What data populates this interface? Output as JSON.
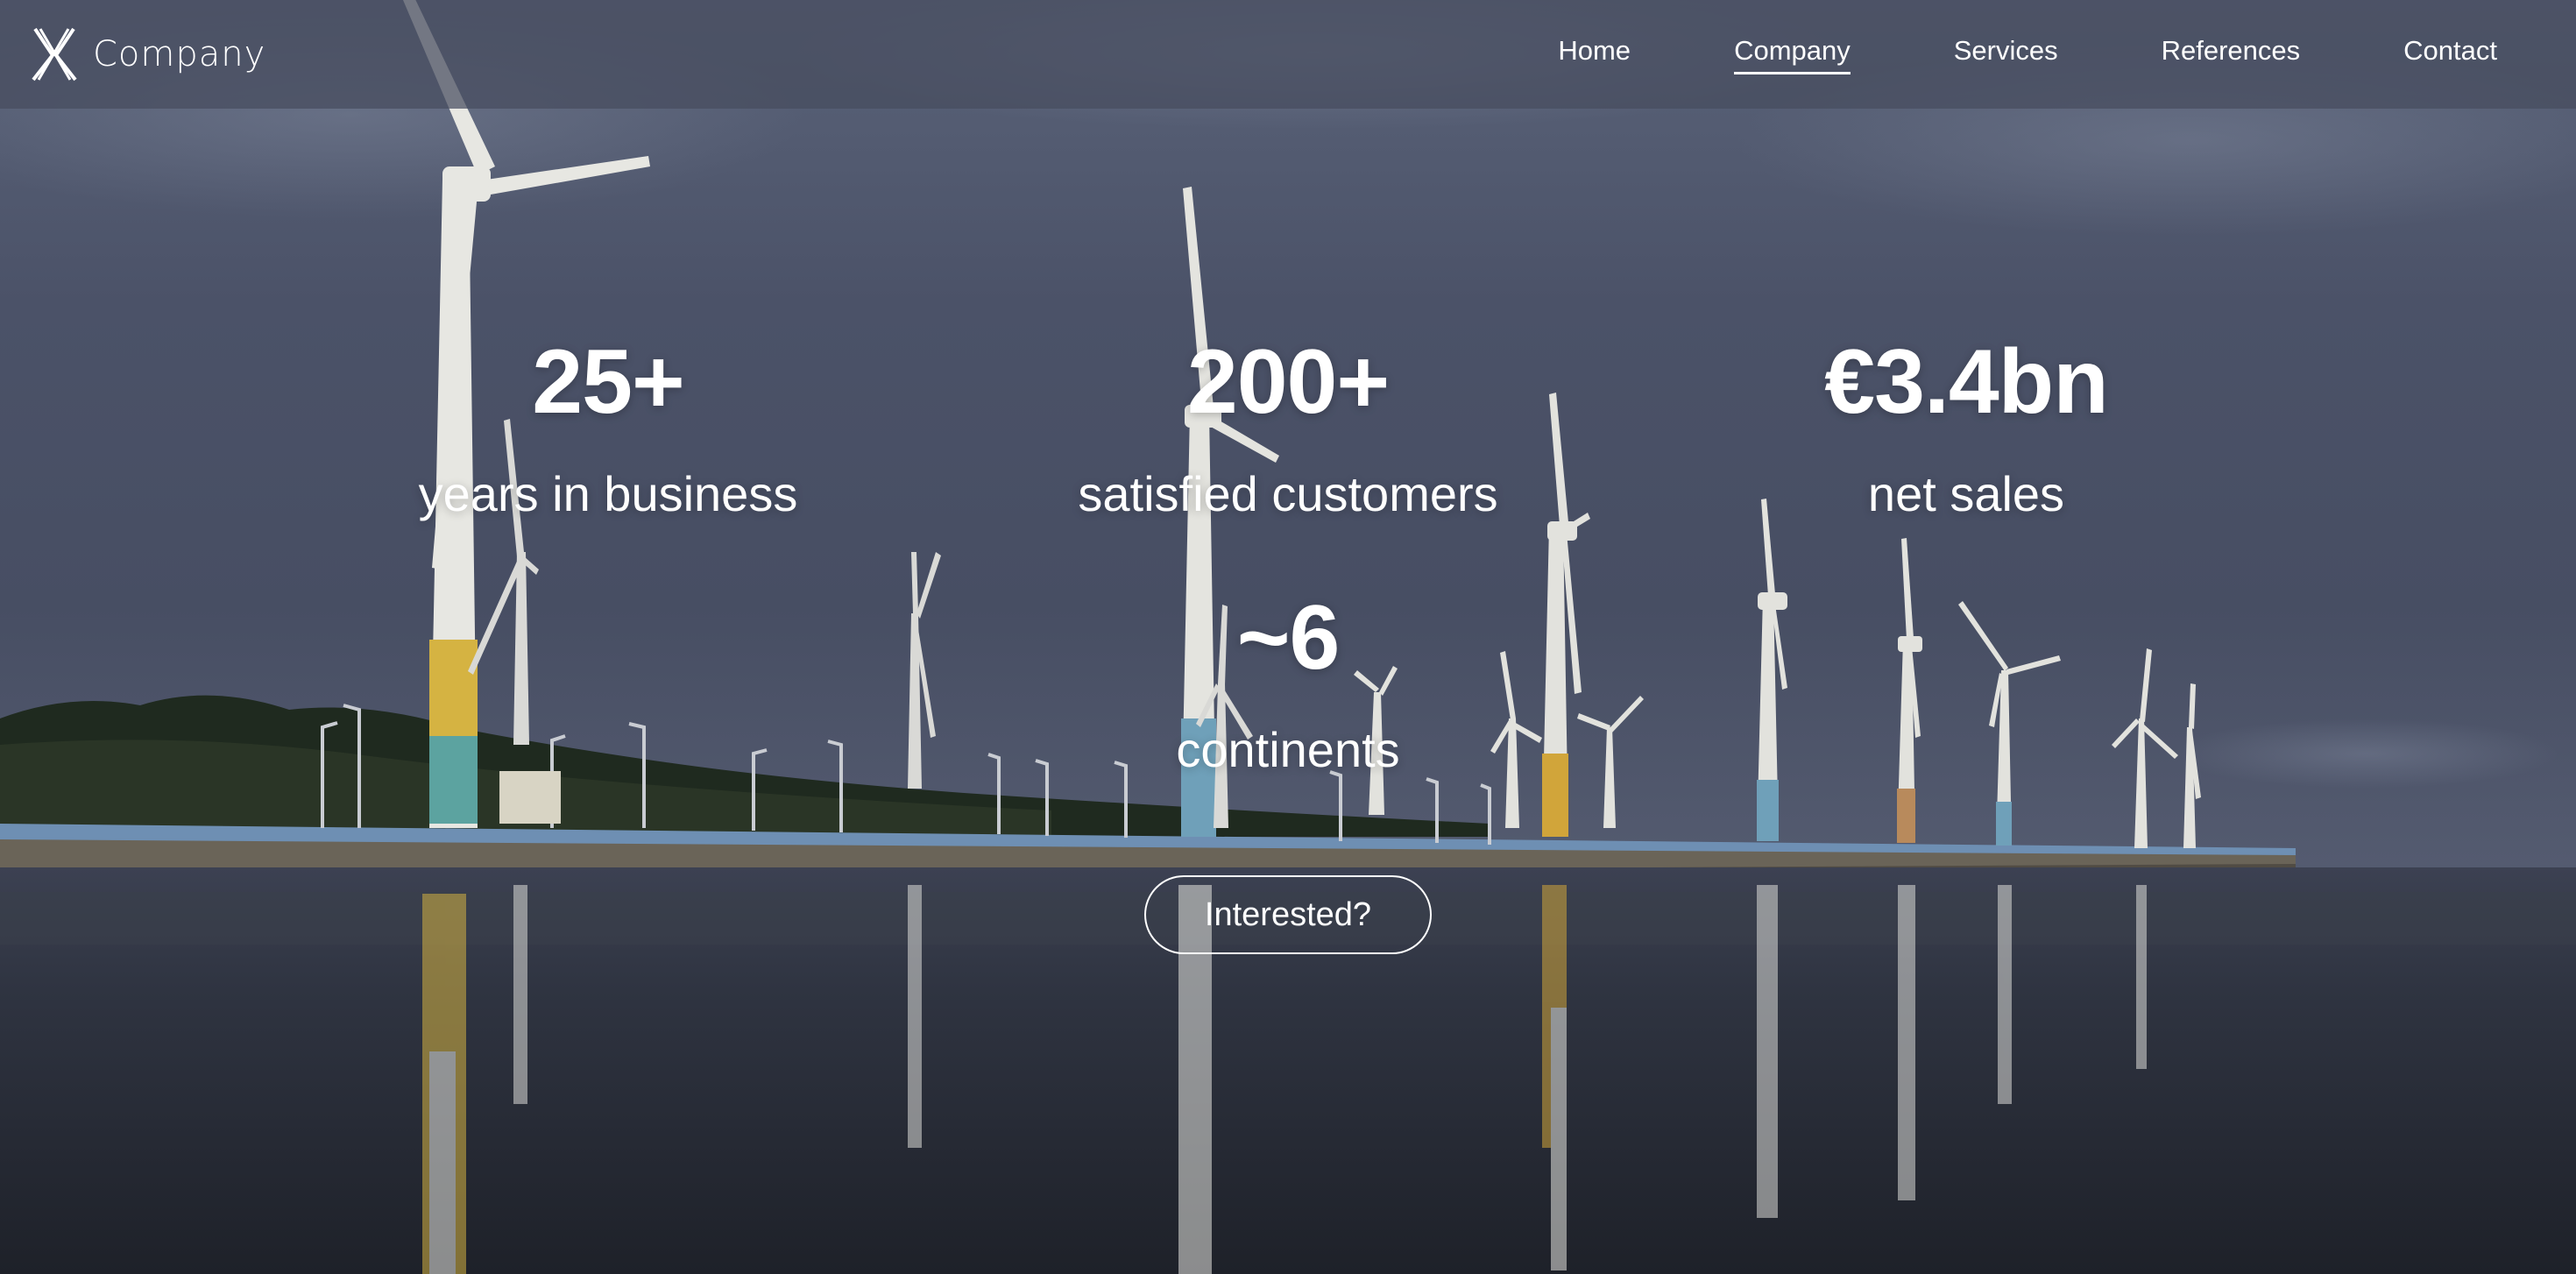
{
  "brand": {
    "logo_icon": "x-logo-icon",
    "name": "Company"
  },
  "nav": {
    "items": [
      {
        "label": "Home",
        "active": false
      },
      {
        "label": "Company",
        "active": true
      },
      {
        "label": "Services",
        "active": false
      },
      {
        "label": "References",
        "active": false
      },
      {
        "label": "Contact",
        "active": false
      }
    ]
  },
  "stats": [
    {
      "value": "25+",
      "label": "years in business"
    },
    {
      "value": "200+",
      "label": "satisfied customers"
    },
    {
      "value": "€3.4bn",
      "label": "net sales"
    },
    {
      "value": "~6",
      "label": "continents"
    }
  ],
  "cta": {
    "label": "Interested?"
  },
  "colors": {
    "navbar_bg": "#464c5e",
    "text": "#ffffff",
    "sky": "#4a5168",
    "water": "#2a2f3a"
  }
}
